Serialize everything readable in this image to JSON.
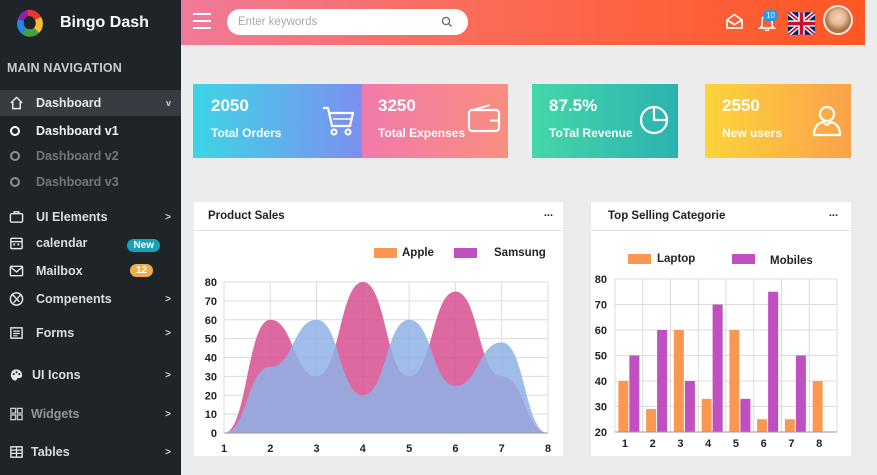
{
  "brand": {
    "name": "Bingo Dash"
  },
  "sidebar": {
    "heading": "MAIN NAVIGATION",
    "dashboard": {
      "label": "Dashboard",
      "chevron": "v"
    },
    "sub": [
      {
        "label": "Dashboard v1"
      },
      {
        "label": "Dashboard v2"
      },
      {
        "label": "Dashboard v3"
      }
    ],
    "items": [
      {
        "label": "UI Elements",
        "chevron": ">"
      },
      {
        "label": "calendar",
        "badge": "New"
      },
      {
        "label": "Mailbox",
        "badge": "12"
      },
      {
        "label": "Compenents",
        "chevron": ">"
      },
      {
        "label": "Forms",
        "chevron": ">"
      },
      {
        "label": "UI Icons",
        "chevron": ">"
      },
      {
        "label": "Widgets",
        "chevron": ">"
      },
      {
        "label": "Tables",
        "chevron": ">"
      }
    ]
  },
  "topbar": {
    "search_placeholder": "Enter keywords",
    "notification_count": "10"
  },
  "cards": [
    {
      "value": "2050",
      "label": "Total Orders",
      "icon": "cart-icon"
    },
    {
      "value": "3250",
      "label": "Total Expenses",
      "icon": "wallet-icon"
    },
    {
      "value": "87.5%",
      "label": "ToTal Revenue",
      "icon": "pie-icon"
    },
    {
      "value": "2550",
      "label": "New users",
      "icon": "user-icon"
    }
  ],
  "chart_data": [
    {
      "type": "area",
      "title": "Product Sales",
      "more": "...",
      "x": [
        1,
        2,
        3,
        4,
        5,
        6,
        7,
        8
      ],
      "series": [
        {
          "name": "Apple",
          "color": "#d6508f",
          "values": [
            0,
            60,
            30,
            80,
            30,
            75,
            30,
            0
          ]
        },
        {
          "name": "Samsung",
          "color": "#8fb1e6",
          "values": [
            0,
            35,
            60,
            20,
            60,
            25,
            48,
            0
          ]
        }
      ],
      "legend_colors": [
        "#fa9752",
        "#c04fc0"
      ],
      "ylim": [
        0,
        80
      ],
      "yticks": [
        0,
        10,
        20,
        30,
        40,
        50,
        60,
        70,
        80
      ],
      "grid": true,
      "legend": "top-right"
    },
    {
      "type": "bar",
      "title": "Top Selling Categorie",
      "more": "...",
      "categories": [
        1,
        2,
        3,
        4,
        5,
        6,
        7,
        8
      ],
      "series": [
        {
          "name": "Laptop",
          "color": "#fa9752",
          "values": [
            40,
            29,
            60,
            33,
            60,
            25,
            25,
            40
          ]
        },
        {
          "name": "Mobiles",
          "color": "#c04fc0",
          "values": [
            50,
            60,
            40,
            70,
            33,
            75,
            50,
            null
          ]
        }
      ],
      "ylim": [
        20,
        80
      ],
      "yticks": [
        20,
        30,
        40,
        50,
        60,
        70,
        80
      ],
      "grid": true,
      "legend": "top-left"
    }
  ]
}
